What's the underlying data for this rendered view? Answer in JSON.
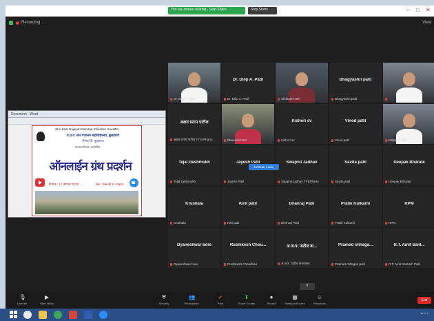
{
  "window": {
    "share_banner": "You are screen sharing · Stop Share",
    "stop_share": "Stop Share"
  },
  "topbar": {
    "recording": "Recording",
    "view": "View"
  },
  "shared_screen": {
    "doc_title": "Document - Word",
    "poster": {
      "header": "Shri Sant Gajanan Maharaj Shikshan Sanstha",
      "college": "ग.प्र.ग. संत गजानन महाविद्यालय, बुलढाणा",
      "place": "शेगाव जि. बुलढाणा",
      "sub": "ग्रंथालय विभाग आयोजित",
      "main": "ऑनलाईन ग्रंथ प्रदर्शन",
      "date1": "दिनांक : 17 ऑगस्ट 2020",
      "date2": "वेळ : सकाळी 11 वाजता"
    }
  },
  "participants": [
    {
      "name": "",
      "caption": "Dr. Dilip A. Patil",
      "video": true
    },
    {
      "name": "Dr. Dilip A. Patil",
      "caption": "Dr. Dilip A. Patil",
      "video": false
    },
    {
      "name": "",
      "caption": "Shrikant Patil",
      "video": true,
      "active": true
    },
    {
      "name": "Bhagyashri patil",
      "caption": "Bhagyashri patil",
      "video": false
    },
    {
      "name": "",
      "caption": "",
      "video": true
    },
    {
      "name": "अक्षय प्रताप पाटील",
      "caption": "अक्षय प्रताप पाटील TY B.Pharm",
      "video": false
    },
    {
      "name": "",
      "caption": "Bhavana Patil",
      "video": true
    },
    {
      "name": "Kishori sv",
      "caption": "Kishori sv",
      "video": false
    },
    {
      "name": "Vinod patil",
      "caption": "Vinod patil",
      "video": false
    },
    {
      "name": "",
      "caption": "Kalpesh Patil",
      "video": true
    },
    {
      "name": "Tejal Deshmukh",
      "caption": "Tejal Deshmukh",
      "video": false
    },
    {
      "name": "Jayesh Patil",
      "caption": "Jayesh Patil",
      "video": false
    },
    {
      "name": "Swapnil Jadhav",
      "caption": "Swapnil Jadhav TYBPharm",
      "video": false
    },
    {
      "name": "Savita patil",
      "caption": "Savita patil",
      "video": false
    },
    {
      "name": "Deepak Bharate",
      "caption": "Deepak Bharate",
      "video": false
    },
    {
      "name": "Krushala",
      "caption": "Krushala",
      "video": false
    },
    {
      "name": "Kirti patil",
      "caption": "Kirti patil",
      "video": false
    },
    {
      "name": "Dhanraj Patil",
      "caption": "Dhanraj Patil",
      "video": false
    },
    {
      "name": "Pratik Kulkarni",
      "caption": "Pratik Kulkarni",
      "video": false
    },
    {
      "name": "RPM",
      "caption": "RPM",
      "video": false
    },
    {
      "name": "Dyaneshwar bore",
      "caption": "Dyaneshwar bore",
      "video": false
    },
    {
      "name": "Rushikesh Chou...",
      "caption": "Rushikesh Choudhari",
      "video": false
    },
    {
      "name": "अ.ज.त्र. पाटील वा...",
      "caption": "अ.ज.त्र. पाटील वाचनालय",
      "video": false
    },
    {
      "name": "Pramod chhaga...",
      "caption": "Pramod chhagan patil",
      "video": false
    },
    {
      "name": "R.T. Amit Sant...",
      "caption": "R.T. Amit Santosh Patil",
      "video": false
    }
  ],
  "audio_pill": "Unmute Audio",
  "toolbar": {
    "items": [
      {
        "label": "Unmute",
        "icon": "mic-icon"
      },
      {
        "label": "Start Video",
        "icon": "video-icon"
      },
      {
        "label": "Security",
        "icon": "shield-icon"
      },
      {
        "label": "Participants",
        "icon": "participants-icon"
      },
      {
        "label": "Polls",
        "icon": "polls-icon"
      },
      {
        "label": "Share Screen",
        "icon": "share-icon"
      },
      {
        "label": "Record",
        "icon": "record-icon"
      },
      {
        "label": "Breakout Rooms",
        "icon": "breakout-icon"
      },
      {
        "label": "Reactions",
        "icon": "reactions-icon"
      }
    ],
    "leave": "End"
  },
  "colors": {
    "accent_green": "#2fa44f",
    "leave_red": "#e02828",
    "active_speaker": "#e6d24a",
    "taskbar": "#2a4e86"
  }
}
